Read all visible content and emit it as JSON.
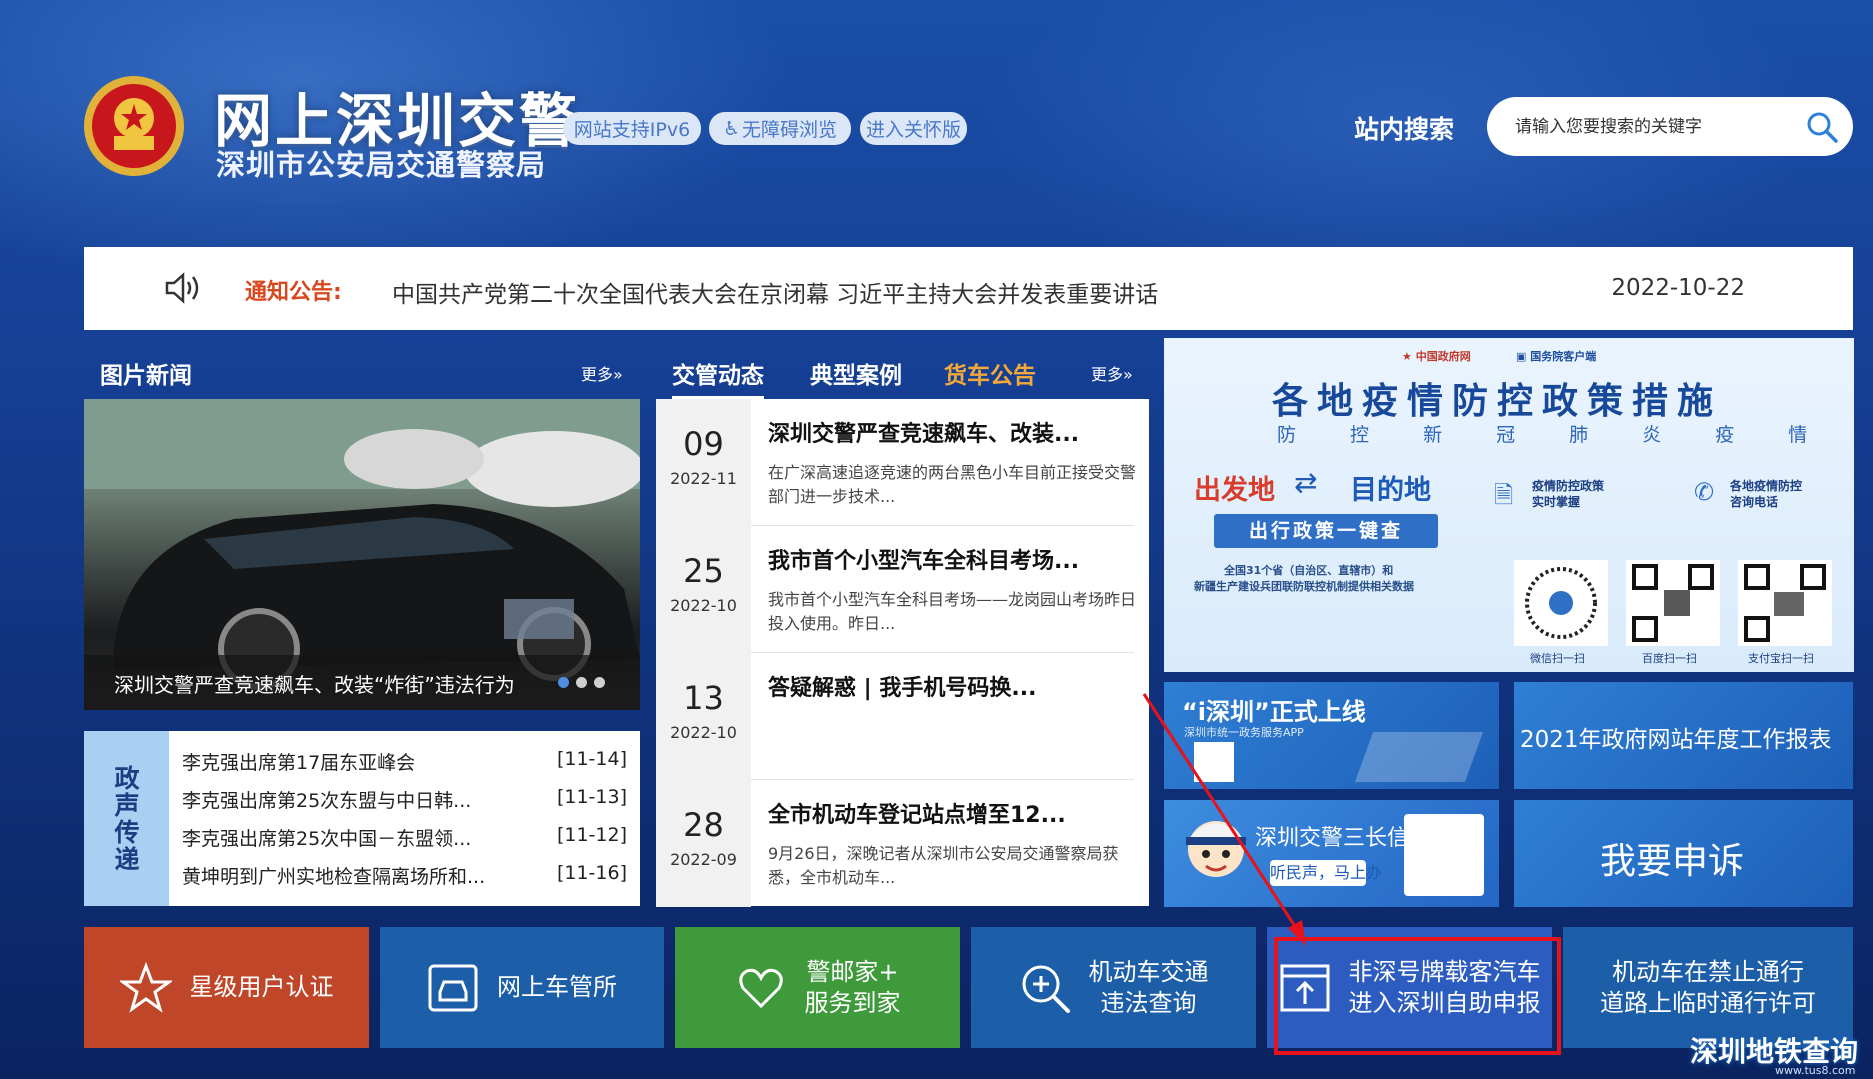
{
  "header": {
    "site_title": "网上深圳交警",
    "site_subtitle": "深圳市公安局交通警察局",
    "badges": [
      "网站支持IPv6",
      "无障碍浏览",
      "进入关怀版"
    ],
    "search_label": "站内搜索",
    "search_placeholder": "请输入您要搜索的关键字"
  },
  "notice": {
    "label": "通知公告:",
    "text": "中国共产党第二十次全国代表大会在京闭幕 习近平主持大会并发表重要讲话",
    "date": "2022-10-22"
  },
  "photo_news": {
    "title": "图片新闻",
    "more": "更多»",
    "caption": "深圳交警严查竞速飙车、改装“炸街”违法行为"
  },
  "gov_affairs": {
    "side_label": "政声传递",
    "items": [
      {
        "title": "李克强出席第17届东亚峰会",
        "date": "[11-14]"
      },
      {
        "title": "李克强出席第25次东盟与中日韩...",
        "date": "[11-13]"
      },
      {
        "title": "李克强出席第25次中国－东盟领...",
        "date": "[11-12]"
      },
      {
        "title": "黄坤明到广州实地检查隔离场所和...",
        "date": "[11-16]"
      }
    ]
  },
  "traffic_news": {
    "tabs": [
      "交管动态",
      "典型案例",
      "货车公告"
    ],
    "more": "更多»",
    "items": [
      {
        "day": "09",
        "ym": "2022-11",
        "title": "深圳交警严查竞速飙车、改装...",
        "summary": "在广深高速追逐竞速的两台黑色小车目前正接受交警部门进一步技术..."
      },
      {
        "day": "25",
        "ym": "2022-10",
        "title": "我市首个小型汽车全科目考场...",
        "summary": "我市首个小型汽车全科目考场——龙岗园山考场昨日投入使用。昨日..."
      },
      {
        "day": "13",
        "ym": "2022-10",
        "title": "答疑解惑 | 我手机号码换...",
        "summary": ""
      },
      {
        "day": "28",
        "ym": "2022-09",
        "title": "全市机动车登记站点增至12...",
        "summary": "9月26日，深晚记者从深圳市公安局交通警察局获悉，全市机动车..."
      }
    ]
  },
  "covid_banner": {
    "top_logos": [
      "中国政府网",
      "国务院客户端"
    ],
    "title": "各地疫情防控政策措施",
    "subtitle": "防 控 新 冠 肺 炎 疫 情",
    "from": "出发地",
    "to": "目的地",
    "button": "出行政策一键查",
    "desc_line1": "全国31个省（自治区、直辖市）和",
    "desc_line2": "新疆生产建设兵团联防联控机制提供相关数据",
    "feature1_title": "疫情防控政策",
    "feature1_sub": "实时掌握",
    "feature2_title": "各地疫情防控",
    "feature2_sub": "咨询电话",
    "qr_labels": [
      "微信扫一扫",
      "百度扫一扫",
      "支付宝扫一扫"
    ]
  },
  "tiles": {
    "ishenzhen_title": "“i深圳”正式上线",
    "ishenzhen_sub": "深圳市统一政务服务APP",
    "report": "2021年政府网站年度工作报表",
    "mailbox_title": "深圳交警三长信箱",
    "mailbox_sub": "听民声，马上办",
    "complaint": "我要申诉"
  },
  "bottom_buttons": [
    {
      "label": "星级用户认证",
      "color": "#c0462a"
    },
    {
      "label": "网上车管所",
      "color": "#1d5ea8"
    },
    {
      "label": "警邮家+\n服务到家",
      "color": "#3f9a3c"
    },
    {
      "label": "机动车交通\n违法查询",
      "color": "#1d5ea8"
    },
    {
      "label": "非深号牌载客汽车\n进入深圳自助申报",
      "color": "#2c5cc0"
    },
    {
      "label": "机动车在禁止通行\n道路上临时通行许可",
      "color": "#1d5ea8"
    }
  ],
  "watermark": {
    "text": "深圳地铁查询",
    "url": "www.tus8.com"
  }
}
